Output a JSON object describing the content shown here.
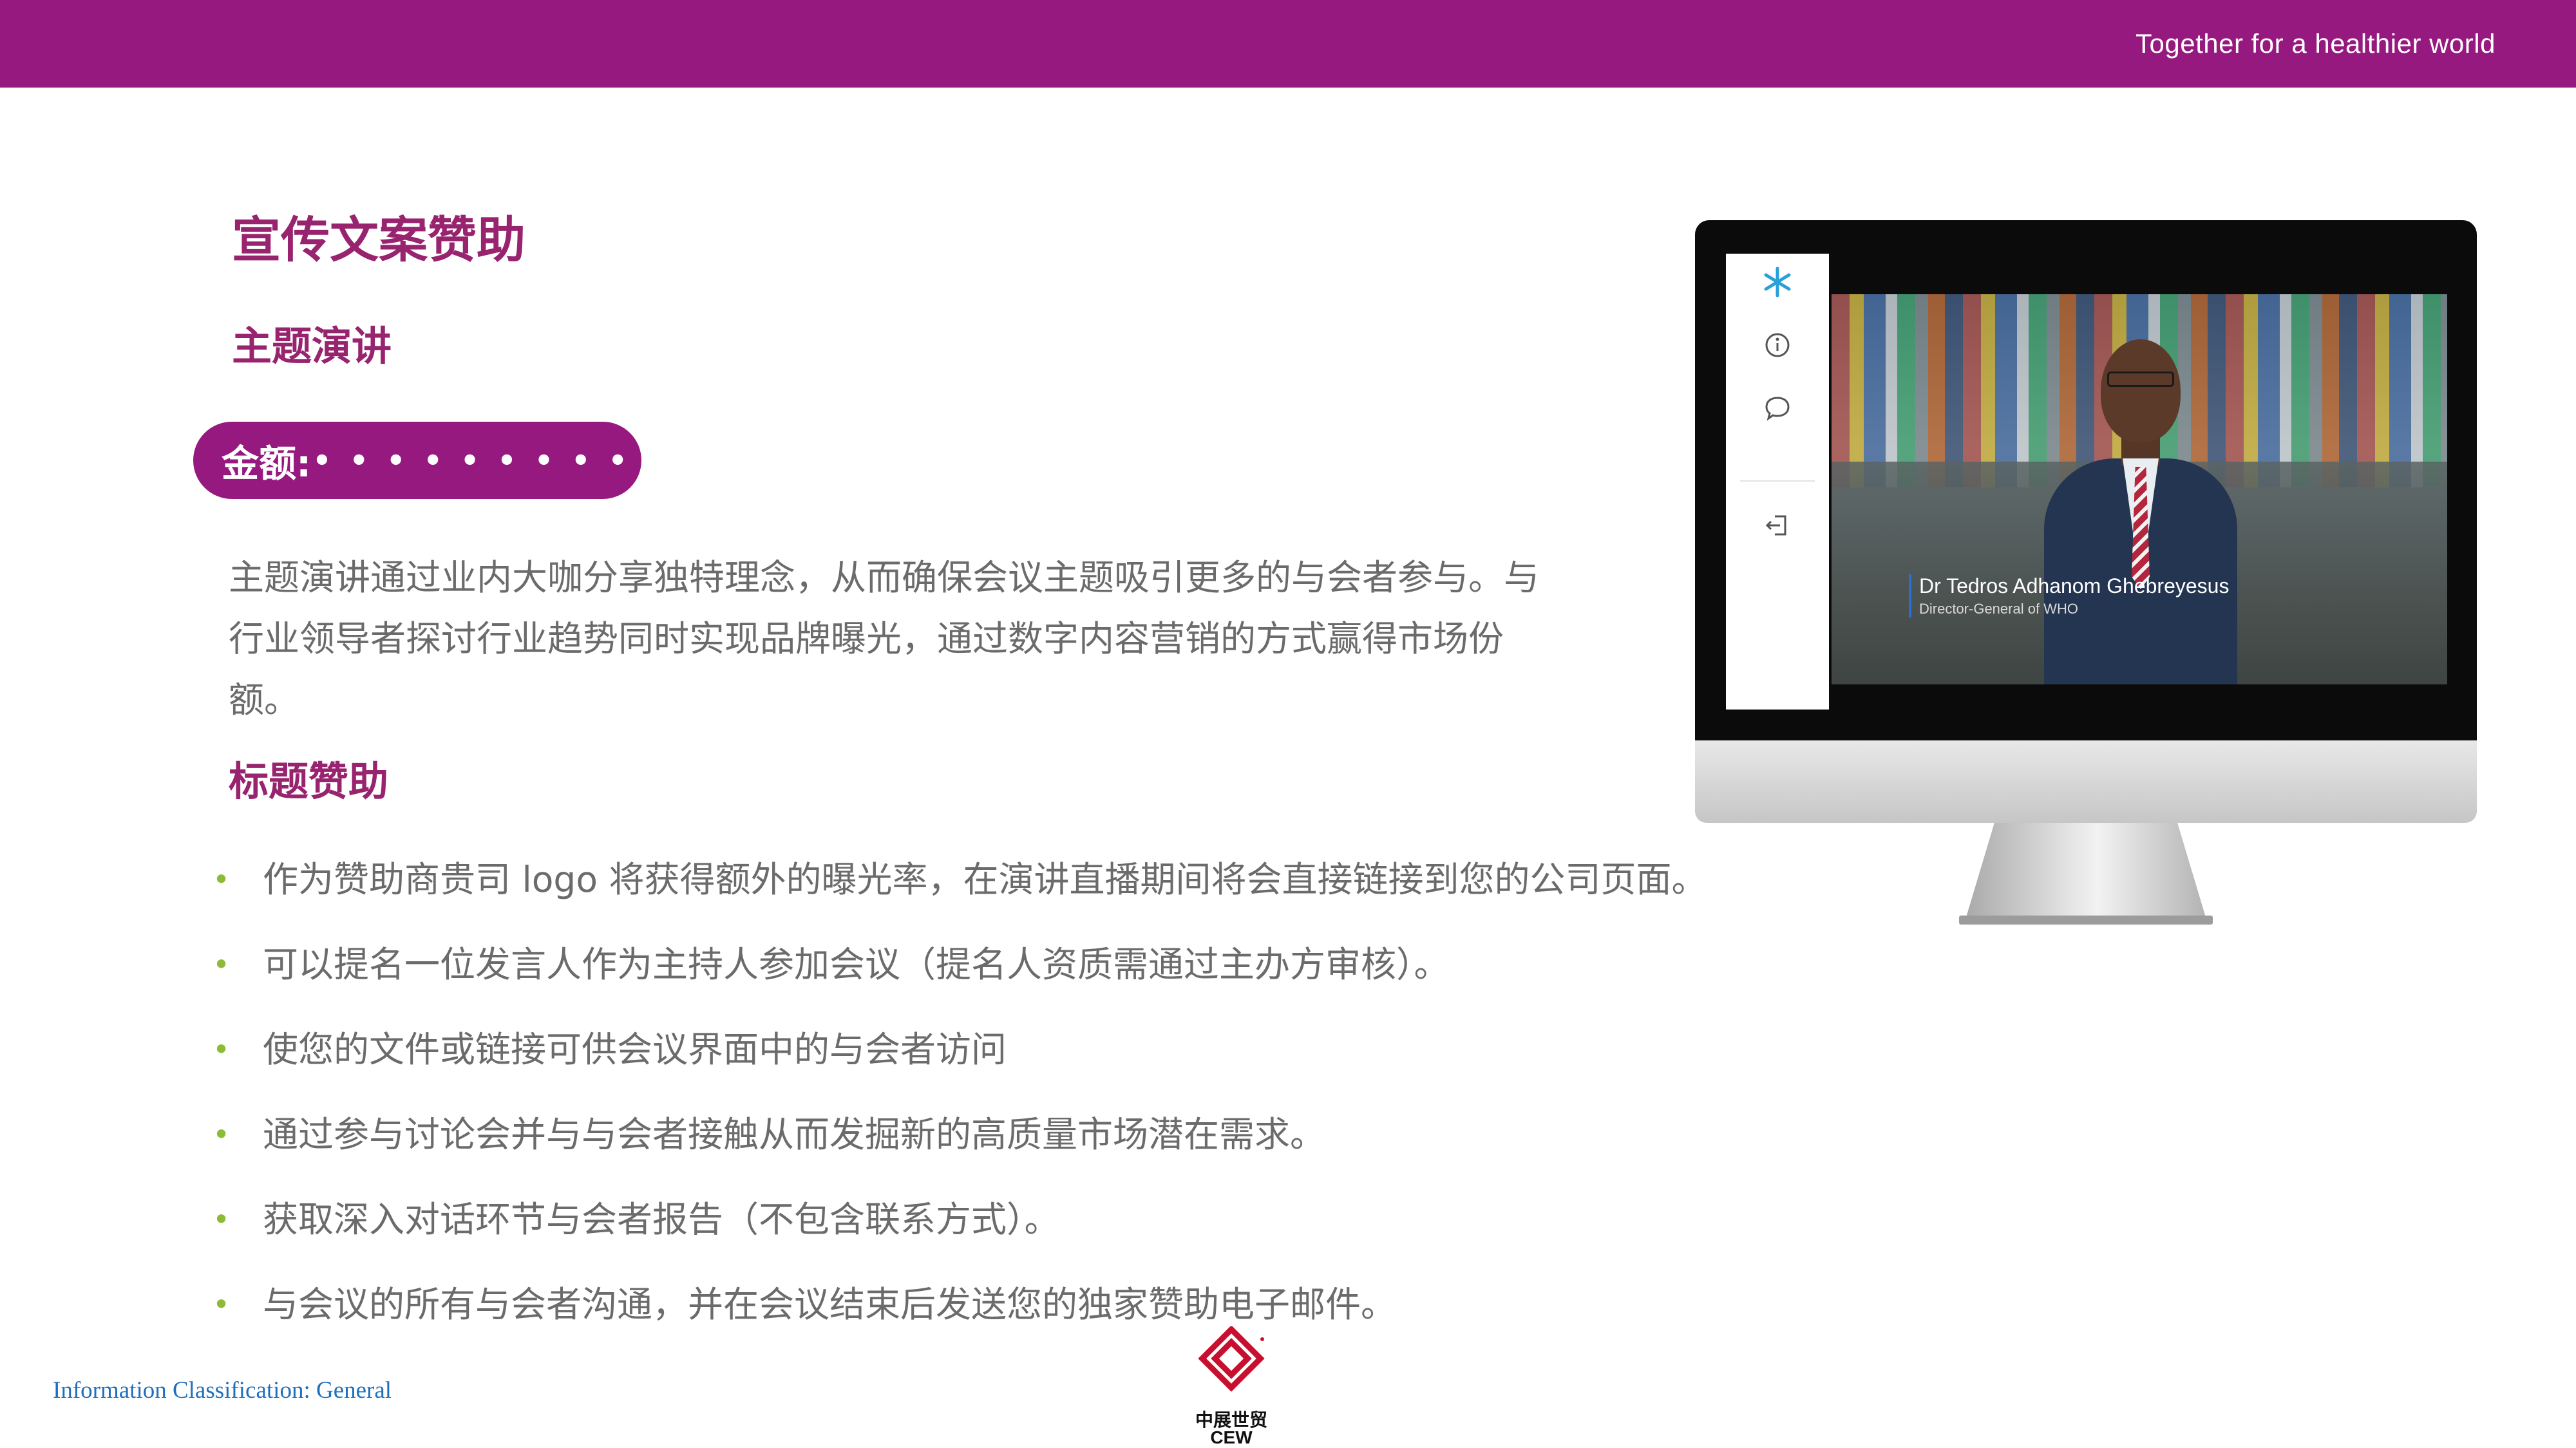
{
  "header": {
    "tagline": "Together for a healthier world",
    "bar_color": "#96197f"
  },
  "main": {
    "title": "宣传文案赞助",
    "keynote_subtitle": "主题演讲",
    "amount_label": "金额:",
    "amount_value": "• • • • • • • • •",
    "intro": "主题演讲通过业内大咖分享独特理念，从而确保会议主题吸引更多的与会者参与。与行业领导者探讨行业趋势同时实现品牌曝光，通过数字内容营销的方式赢得市场份额。",
    "title_sponsorship_subtitle": "标题赞助",
    "bullets": [
      "作为赞助商贵司 logo 将获得额外的曝光率，在演讲直播期间将会直接链接到您的公司页面。",
      "可以提名一位发言人作为主持人参加会议（提名人资质需通过主办方审核）。",
      "使您的文件或链接可供会议界面中的与会者访问",
      "通过参与讨论会并与与会者接触从而发掘新的高质量市场潜在需求。",
      "获取深入对话环节与会者报告（不包含联系方式）。",
      "与会议的所有与会者沟通，并在会议结束后发送您的独家赞助电子邮件。"
    ]
  },
  "monitor": {
    "speaker_name": "Dr Tedros Adhanom Ghebreyesus",
    "speaker_title": "Director-General of WHO",
    "side_icons": [
      "snowflake-icon",
      "info-icon",
      "chat-icon",
      "exit-icon"
    ]
  },
  "footer": {
    "classification": "Information Classification: General",
    "logo_cn": "中展世贸",
    "logo_en": "CEW"
  },
  "colors": {
    "brand_purple": "#96197f",
    "heading_purple": "#98236e",
    "bullet_green": "#8dbb35",
    "body_gray": "#6b6b6b",
    "classification_blue": "#1f6fbd"
  }
}
